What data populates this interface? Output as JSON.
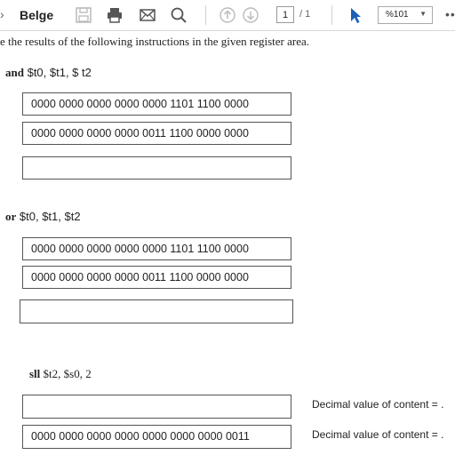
{
  "toolbar": {
    "caret": "›",
    "title": "Belge",
    "page_current": "1",
    "page_total": "/ 1",
    "zoom": "%101",
    "more": "••"
  },
  "document": {
    "intro": "e the results of the following instructions in the given register area.",
    "sections": [
      {
        "keyword": "and",
        "operands": "$t0, $t1, $ t2",
        "registers": [
          "0000 0000 0000 0000 0000 1101 1100 0000",
          "0000 0000 0000 0000 0011 1100 0000 0000",
          ""
        ]
      },
      {
        "keyword": "or",
        "operands": "$t0, $t1, $t2",
        "registers": [
          "0000 0000 0000 0000 0000 1101 1100 0000",
          "0000 0000 0000 0000 0011 1100 0000 0000",
          ""
        ]
      },
      {
        "keyword": "sll",
        "operands": "$t2, $s0, 2",
        "registers": [
          "",
          "0000 0000 0000 0000 0000 0000 0000 0011"
        ],
        "notes": [
          "Decimal value of content = .",
          "Decimal value of content = ."
        ]
      }
    ]
  }
}
